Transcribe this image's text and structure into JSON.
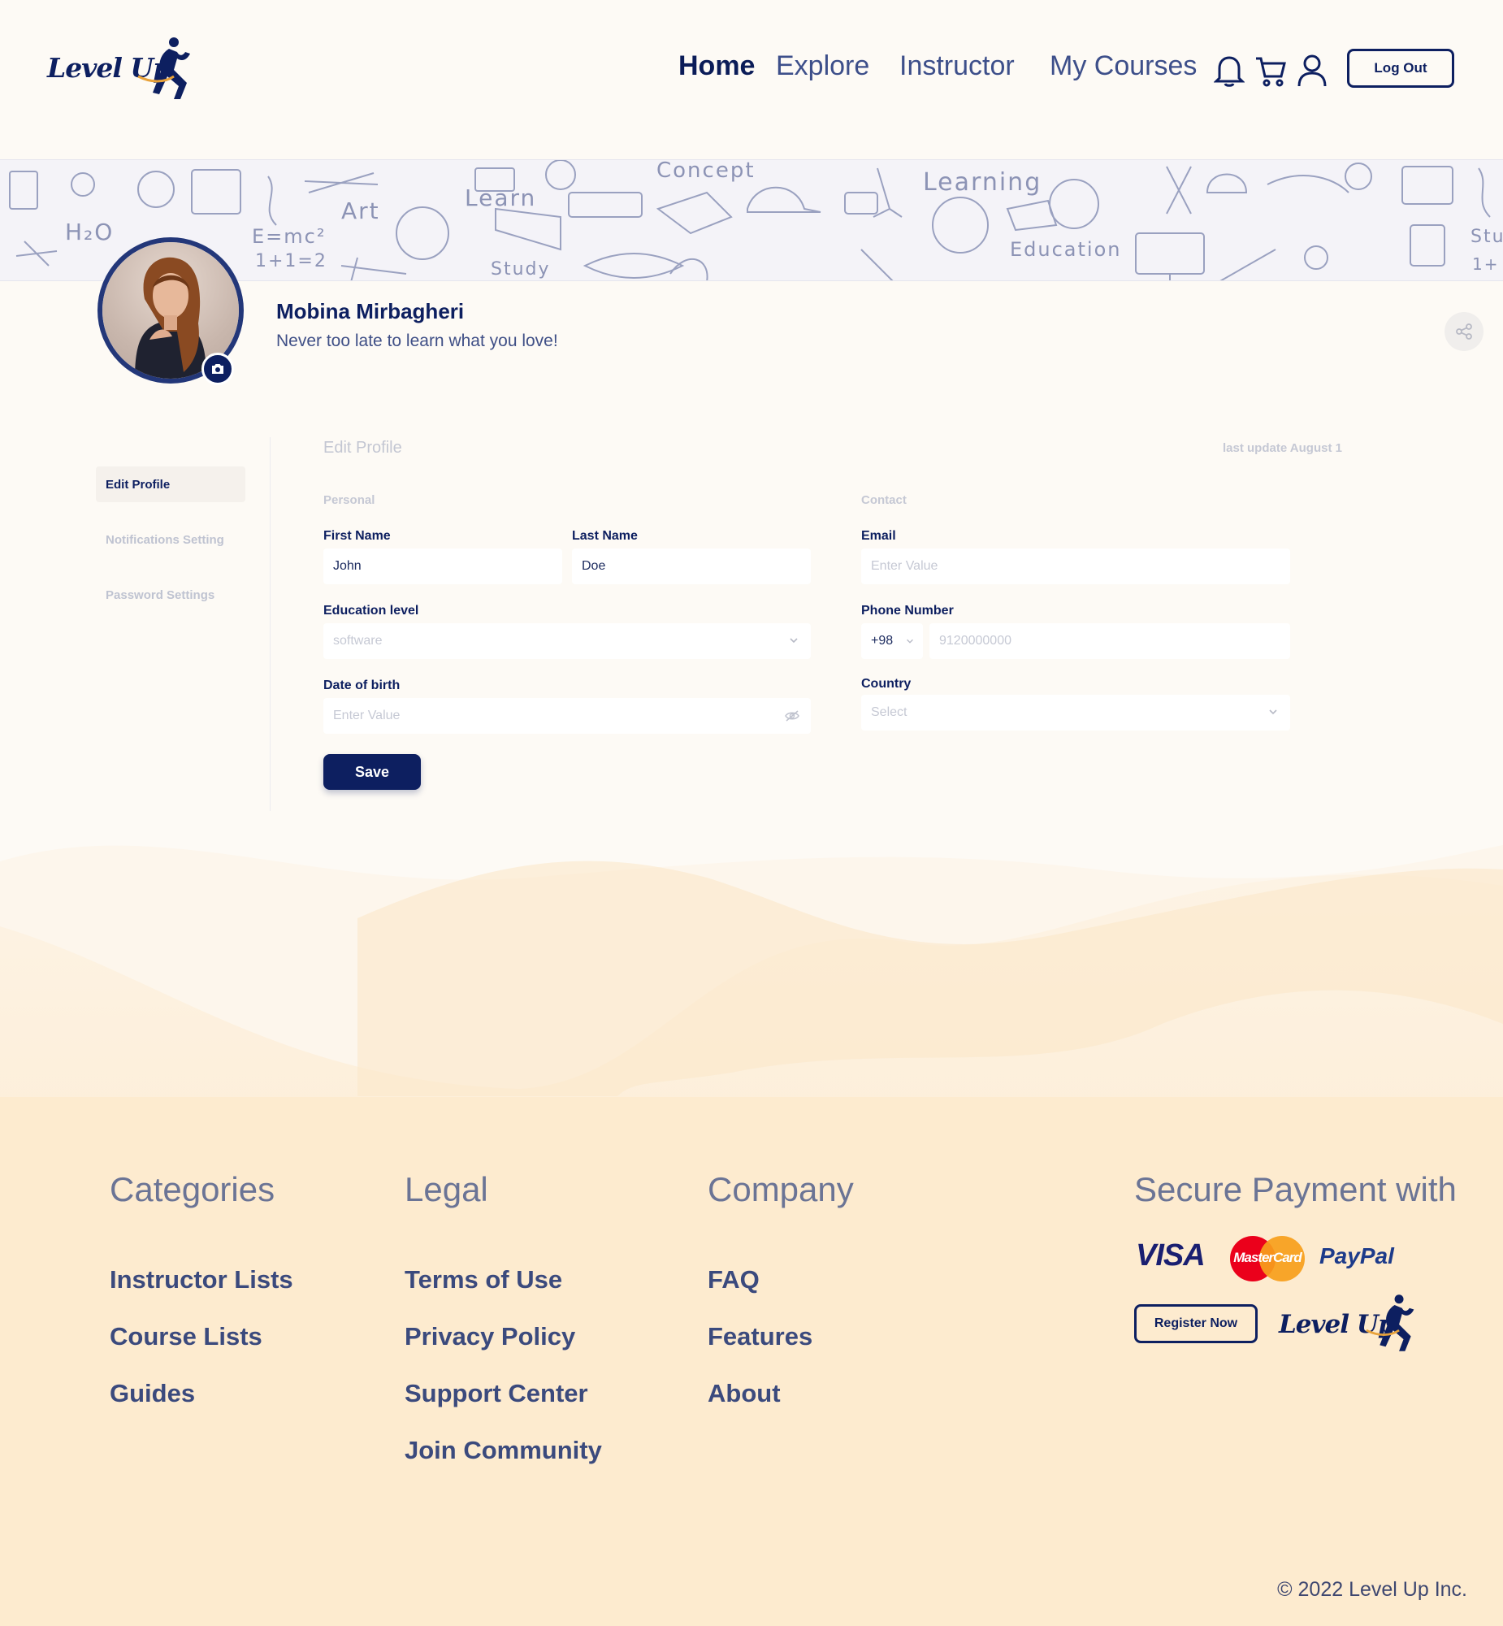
{
  "brand": {
    "logo_text": "Level Up"
  },
  "nav": {
    "items": [
      {
        "label": "Home",
        "active": true
      },
      {
        "label": "Explore"
      },
      {
        "label": "Instructor"
      },
      {
        "label": "My Courses"
      }
    ],
    "icons": [
      "bell-icon",
      "cart-icon",
      "user-icon"
    ],
    "logout_label": "Log Out"
  },
  "banner": {
    "words": [
      "H₂O",
      "Art",
      "E=mc²",
      "1+1=2",
      "Learn",
      "Study",
      "Concept",
      "Learning",
      "Education",
      "Stu",
      "1+"
    ]
  },
  "profile": {
    "name": "Mobina Mirbagheri",
    "tagline": "Never too late to learn what you love!"
  },
  "sidebar": {
    "items": [
      {
        "label": "Edit Profile",
        "active": true
      },
      {
        "label": "Notifications Setting"
      },
      {
        "label": "Password Settings"
      }
    ]
  },
  "form": {
    "title": "Edit Profile",
    "last_update": "last update August 1",
    "personal_label": "Personal",
    "contact_label": "Contact",
    "first_name": {
      "label": "First Name",
      "value": "John"
    },
    "last_name": {
      "label": "Last Name",
      "value": "Doe"
    },
    "education": {
      "label": "Education level",
      "value": "software"
    },
    "dob": {
      "label": "Date of birth",
      "placeholder": "Enter Value"
    },
    "email": {
      "label": "Email",
      "placeholder": "Enter Value"
    },
    "phone": {
      "label": "Phone Number",
      "code": "+98",
      "placeholder": "9120000000"
    },
    "country": {
      "label": "Country",
      "placeholder": "Select"
    },
    "save_label": "Save"
  },
  "footer": {
    "columns": [
      {
        "title": "Categories",
        "links": [
          "Instructor Lists",
          "Course Lists",
          "Guides"
        ]
      },
      {
        "title": "Legal",
        "links": [
          "Terms of Use",
          "Privacy Policy",
          "Support Center",
          "Join Community"
        ]
      },
      {
        "title": "Company",
        "links": [
          "FAQ",
          "Features",
          "About"
        ]
      }
    ],
    "payment_title": "Secure Payment with",
    "payment_logos": {
      "visa": "VISA",
      "mastercard": "MasterCard",
      "paypal": "PayPal"
    },
    "register_label": "Register Now",
    "copyright": "© 2022 Level Up Inc."
  },
  "colors": {
    "primary": "#0d1f60",
    "nav_text": "#3d4f8a",
    "footer_bg": "#fdebcf",
    "muted": "#c3c6d2"
  }
}
